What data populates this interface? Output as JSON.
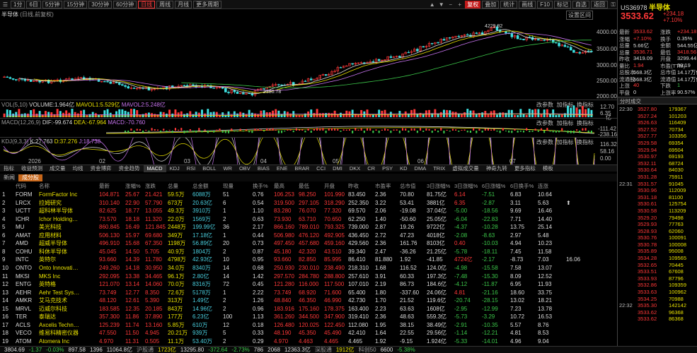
{
  "toolbar": {
    "periods": [
      "1分",
      "6日",
      "5分钟",
      "15分钟",
      "30分钟",
      "60分钟",
      "日线",
      "周线",
      "月线",
      "更多周期"
    ],
    "active": "日线",
    "right_items": [
      "复权",
      "叠加",
      "统计",
      "画线",
      "F10",
      "标记",
      "自选",
      "返回"
    ]
  },
  "kline": {
    "name": "半导体",
    "mode": "(日线,前复权)",
    "high_label": "4229.82",
    "low_label": "2380.78",
    "yaxis": [
      "4000.00",
      "3500.00",
      "3000.00",
      "2500.00",
      "2000.00"
    ],
    "settings": "设置区间"
  },
  "volume": {
    "title": "VOL(5,10)",
    "vol_label": "VOLUME:",
    "vol_val": "1.964亿",
    "ma1_label": "MAVOL1:",
    "ma1_val": "5.529亿",
    "ma2_label": "MAVOL2:",
    "ma2_val": "5.248亿",
    "links": [
      "改参数",
      "加指标",
      "换指标"
    ],
    "yaxis": [
      "12.70",
      "6.35",
      "亿"
    ]
  },
  "macd": {
    "title": "MACD(12,26,9)",
    "dif": "DIF:-99.674",
    "dea": "DEA:-67.964",
    "macd": "MACD:-70.760",
    "yaxis": [
      "-111.42",
      "-238.16"
    ],
    "links": [
      "改参数",
      "加指标",
      "换指标"
    ]
  },
  "kdj": {
    "title": "KDJ(9,3,3)",
    "k": "K:27.763",
    "d": "D:37.276",
    "j": "J:18.738",
    "yaxis": [
      "116.32",
      "58.16",
      "0.00"
    ],
    "links": [
      "改参数",
      "加指标",
      "换指标"
    ],
    "dates": [
      "2026",
      "02",
      "03",
      "04",
      "05",
      "06",
      "07"
    ]
  },
  "indicator_tabs": [
    "指标",
    "收益预测",
    "成交量",
    "均线",
    "资金博弈",
    "资金趋势",
    "MACD",
    "KDJ",
    "RSI",
    "BOLL",
    "WR",
    "OBV",
    "BIAS",
    "ENE",
    "BRAR",
    "CCI",
    "DMI",
    "DKX",
    "CR",
    "PSY",
    "KD",
    "DMA",
    "TRIX",
    "虚拟成交量",
    "神奇九转",
    "更多指标",
    "模板"
  ],
  "indicator_active": "MACD",
  "table": {
    "tabs": [
      "新闻",
      "成分股"
    ],
    "active_tab": "成分股",
    "headers": [
      "",
      "代码",
      "名称",
      "最新",
      "涨幅%",
      "涨跌",
      "总量",
      "总金额",
      "现量",
      "换手%",
      "最高",
      "最低",
      "开盘",
      "昨收",
      "市盈率",
      "总市值",
      "3日涨幅%",
      "3日涨幅%",
      "6日涨幅%",
      "6日换手%",
      "连涨"
    ],
    "rows": [
      [
        "1",
        "FORM",
        "FormFactor Inc",
        "104.871",
        "25.67",
        "21.421",
        "59.5万",
        "6088万",
        "51",
        "0.76",
        "106.253",
        "98.250",
        "101.990",
        "83.450",
        "2.36",
        "70.80",
        "81.75亿",
        "6.14",
        "-7.51",
        "6.83",
        "10.64",
        ""
      ],
      [
        "2",
        "LRCX",
        "拉姆研究",
        "310.140",
        "22.90",
        "57.790",
        "673万",
        "20.63亿",
        "6",
        "0.54",
        "319.500",
        "297.105",
        "318.290",
        "252.350",
        "3.22",
        "53.41",
        "3881亿",
        "6.35",
        "-2.87",
        "3.11",
        "5.63",
        "⬆"
      ],
      [
        "3",
        "UCTT",
        "超科林半导体",
        "82.625",
        "18.77",
        "13.055",
        "49.3万",
        "3910万",
        "1",
        "1.10",
        "83.280",
        "76.070",
        "77.320",
        "69.570",
        "2.06",
        "-19.08",
        "37.04亿",
        "-5.00",
        "-18.56",
        "9.69",
        "16.46",
        ""
      ],
      [
        "4",
        "ICHR",
        "Ichor Holding…",
        "73.570",
        "18.18",
        "11.320",
        "22.0万",
        "1569万",
        "2",
        "0.63",
        "73.930",
        "63.710",
        "70.650",
        "62.250",
        "1.40",
        "-50.60",
        "25.05亿",
        "-6.04",
        "-22.83",
        "7.71",
        "14.40",
        ""
      ],
      [
        "5",
        "MU",
        "美光科技",
        "860.845",
        "16.49",
        "121.845",
        "2448万",
        "199.99亿",
        "36",
        "2.17",
        "866.160",
        "789.010",
        "793.325",
        "739.000",
        "2.87",
        "19.26",
        "9722亿",
        "-4.37",
        "-10.28",
        "13.75",
        "25.14",
        ""
      ],
      [
        "6",
        "AMAT",
        "应用材料",
        "506.130",
        "15.97",
        "69.680",
        "349万",
        "17.18亿",
        "1",
        "0.44",
        "506.980",
        "476.120",
        "492.905",
        "436.450",
        "2.72",
        "47.23",
        "4018亿",
        "-2.08",
        "-8.63",
        "2.97",
        "5.48",
        ""
      ],
      [
        "7",
        "AMD",
        "超威半导体",
        "496.910",
        "15.68",
        "67.350",
        "1198万",
        "56.89亿",
        "20",
        "0.73",
        "497.450",
        "457.680",
        "459.160",
        "429.560",
        "2.36",
        "161.76",
        "8103亿",
        "0.40",
        "-10.03",
        "4.94",
        "10.23",
        ""
      ],
      [
        "8",
        "COHU",
        "科休半导体",
        "45.045",
        "14.50",
        "5.705",
        "40.9万",
        "1804万",
        "2",
        "0.87",
        "45.180",
        "42.320",
        "43.510",
        "39.340",
        "2.47",
        "-36.26",
        "21.25亿",
        "-5.78",
        "-18.11",
        "7.45",
        "11.58",
        ""
      ],
      [
        "9",
        "INTC",
        "英特尔",
        "93.660",
        "14.39",
        "11.780",
        "4798万",
        "42.93亿",
        "10",
        "0.95",
        "93.660",
        "82.850",
        "85.995",
        "86.410",
        "81.880",
        "1.92",
        "-41.85",
        "4724亿",
        "-2.17",
        "-8.73",
        "7.03",
        "16.06"
      ],
      [
        "10",
        "ONTO",
        "Onto Innovati…",
        "249.260",
        "14.18",
        "30.950",
        "34.0万",
        "8340万",
        "14",
        "0.68",
        "250.930",
        "230.010",
        "238.490",
        "218.310",
        "1.68",
        "116.52",
        "124.0亿",
        "-4.98",
        "-15.58",
        "7.58",
        "13.07",
        ""
      ],
      [
        "11",
        "MKSI",
        "MKS Inc",
        "292.095",
        "13.38",
        "34.465",
        "96.1万",
        "2.80亿",
        "14",
        "1.42",
        "297.570",
        "284.780",
        "288.800",
        "257.610",
        "3.91",
        "60.33",
        "197.3亿",
        "-7.48",
        "-15.30",
        "8.09",
        "12.52",
        ""
      ],
      [
        "12",
        "ENTG",
        "英特格",
        "121.070",
        "13.14",
        "14.060",
        "70.0万",
        "8316万",
        "72",
        "0.45",
        "121.280",
        "116.000",
        "117.500",
        "107.010",
        "2.19",
        "86.73",
        "184.6亿",
        "-4.12",
        "-11.87",
        "6.95",
        "11.93",
        ""
      ],
      [
        "13",
        "AEHR",
        "Aehr Test Sys…",
        "73.749",
        "12.77",
        "8.350",
        "72.6万",
        "5178万",
        "1",
        "2.22",
        "73.749",
        "68.920",
        "71.600",
        "65.400",
        "1.80",
        "-337.60",
        "24.06亿",
        "4.81",
        "-21.16",
        "18.60",
        "33.75",
        ""
      ],
      [
        "14",
        "AMKR",
        "艾马克技术",
        "48.120",
        "12.61",
        "5.390",
        "313万",
        "1.49亿",
        "2",
        "1.26",
        "48.840",
        "46.350",
        "46.990",
        "42.730",
        "1.70",
        "21.52",
        "119.6亿",
        "-20.74",
        "-28.15",
        "13.02",
        "18.21",
        ""
      ],
      [
        "15",
        "MRVL",
        "迈威尔科技",
        "183.585",
        "12.35",
        "20.185",
        "843万",
        "14.96亿",
        "2",
        "0.96",
        "183.916",
        "175.160",
        "178.375",
        "163.400",
        "2.23",
        "63.63",
        "1608亿",
        "-2.95",
        "-12.99",
        "7.23",
        "13.78",
        ""
      ],
      [
        "16",
        "TER",
        "泰瑞达",
        "357.300",
        "11.86",
        "37.890",
        "177万",
        "6.23亿",
        "100",
        "1.13",
        "361.260",
        "344.500",
        "347.900",
        "319.410",
        "2.36",
        "48.63",
        "559.3亿",
        "-5.73",
        "-3.29",
        "10.72",
        "16.53",
        ""
      ],
      [
        "17",
        "ACLS",
        "Axcelis Techn…",
        "125.239",
        "11.74",
        "13.160",
        "5.85万",
        "610万",
        "12",
        "0.18",
        "126.480",
        "120.025",
        "122.450",
        "112.080",
        "1.95",
        "38.15",
        "38.49亿",
        "-2.91",
        "-10.35",
        "5.57",
        "8.76",
        ""
      ],
      [
        "18",
        "VECO",
        "维易科精密仪器",
        "47.550",
        "11.50",
        "4.945",
        "20.21万",
        "939万",
        "5",
        "0.33",
        "48.190",
        "45.350",
        "45.490",
        "42.410",
        "1.64",
        "22.55",
        "29.56亿",
        "-1.14",
        "-12.21",
        "4.81",
        "8.53",
        ""
      ],
      [
        "19",
        "ATOM",
        "Atomera Inc",
        "4.970",
        "11.31",
        "0.505",
        "11.1万",
        "53.40万",
        "2",
        "0.29",
        "4.970",
        "4.463",
        "4.465",
        "4.465",
        "1.92",
        "-9.15",
        "1.924亿",
        "-5.33",
        "-14.01",
        "4.96",
        "9.04",
        ""
      ]
    ]
  },
  "status": {
    "items": [
      {
        "t": "3804.69",
        "c": "wht"
      },
      {
        "t": "-1.37",
        "c": "grn"
      },
      {
        "t": "-0.03%",
        "c": "grn"
      },
      {
        "t": "897.58",
        "c": "wht"
      },
      {
        "t": "1396",
        "c": "wht"
      },
      {
        "t": "11064.8亿",
        "c": "wht"
      },
      {
        "t": "沪股通",
        "c": "gry"
      },
      {
        "t": "1723亿",
        "c": "yel"
      },
      {
        "t": "13295.80",
        "c": "wht"
      },
      {
        "t": "-372.64",
        "c": "grn"
      },
      {
        "t": "-2.73%",
        "c": "grn"
      },
      {
        "t": "786",
        "c": "wht"
      },
      {
        "t": "2068",
        "c": "wht"
      },
      {
        "t": "12363.3亿",
        "c": "wht"
      },
      {
        "t": "深股通",
        "c": "gry"
      },
      {
        "t": "1912亿",
        "c": "yel"
      },
      {
        "t": "科创50",
        "c": "gry"
      },
      {
        "t": "6600",
        "c": "wht"
      },
      {
        "t": "-5.38%",
        "c": "grn"
      }
    ]
  },
  "right_panel": {
    "code": "US36978",
    "name": "半导体",
    "price": "3533.62",
    "change": "+234.18",
    "pct": "+7.10%",
    "stats": [
      [
        "最新",
        "3533.62",
        "red",
        "涨跌",
        "+234.18",
        "red"
      ],
      [
        "涨幅",
        "+7.10%",
        "red",
        "换手",
        "0.35%",
        "wht"
      ],
      [
        "总量",
        "5.66亿",
        "wht",
        "金额",
        "544.55亿",
        "wht"
      ],
      [
        "总量",
        "3536.71",
        "red",
        "最低",
        "3418.56",
        "red"
      ],
      [
        "昨收",
        "3419.09",
        "wht",
        "开盘",
        "3299.44",
        "wht"
      ],
      [
        "量比",
        "1.94",
        "red",
        "市盈(TTM)",
        "38.19",
        "wht"
      ],
      [
        "总股本",
        "568.3亿",
        "wht",
        "总市值",
        "14.17万亿",
        "wht"
      ],
      [
        "流通股",
        "568.3亿",
        "wht",
        "流通值",
        "14.17万亿",
        "wht"
      ],
      [
        "上涨",
        "40",
        "red",
        "下跌",
        "1",
        "grn"
      ],
      [
        "平盘",
        "0",
        "wht",
        "上涨率",
        "90.57%",
        "wht"
      ]
    ],
    "section": "分时成交",
    "ticks": [
      [
        "22:30",
        "3527.80",
        "179367"
      ],
      [
        "",
        "3527.24",
        "101203"
      ],
      [
        "",
        "3526.63",
        "116409"
      ],
      [
        "",
        "3527.52",
        "70734"
      ],
      [
        "",
        "3527.77",
        "103356"
      ],
      [
        "",
        "3529.58",
        "69354"
      ],
      [
        "",
        "3529.94",
        "69504"
      ],
      [
        "",
        "3530.97",
        "69193"
      ],
      [
        "",
        "3532.11",
        "68724"
      ],
      [
        "",
        "3530.64",
        "84030"
      ],
      [
        "",
        "3531.28",
        "75911"
      ],
      [
        "22:31",
        "3531.57",
        "91045"
      ],
      [
        "",
        "3530.96",
        "112009"
      ],
      [
        "",
        "3531.18",
        "81100"
      ],
      [
        "",
        "3530.61",
        "125754"
      ],
      [
        "",
        "3530.58",
        "113209"
      ],
      [
        "",
        "3529.20",
        "79498"
      ],
      [
        "",
        "3529.93",
        "77763"
      ],
      [
        "",
        "3528.93",
        "62060"
      ],
      [
        "",
        "3530.76",
        "100091"
      ],
      [
        "",
        "3530.78",
        "100008"
      ],
      [
        "",
        "3535.89",
        "95008"
      ],
      [
        "",
        "3534.28",
        "109565"
      ],
      [
        "",
        "3532.65",
        "70445"
      ],
      [
        "",
        "3533.51",
        "67608"
      ],
      [
        "",
        "3533.93",
        "87796"
      ],
      [
        "",
        "3532.86",
        "109359"
      ],
      [
        "",
        "3533.63",
        "100962"
      ],
      [
        "",
        "3534.25",
        "70988"
      ],
      [
        "22:32",
        "3535.30",
        "142142"
      ],
      [
        "",
        "3533.62",
        "96368"
      ],
      [
        "",
        "3533.62",
        "86368"
      ]
    ]
  }
}
